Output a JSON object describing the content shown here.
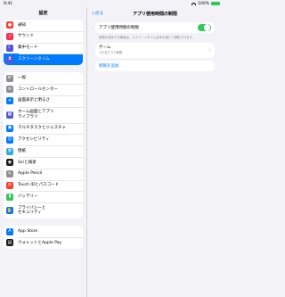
{
  "status_bar": {
    "time": "9:41",
    "battery": "100%"
  },
  "sidebar": {
    "title": "設定",
    "groups": [
      [
        {
          "label": "通知",
          "icon": "bell-icon",
          "color": "#ff3b30"
        },
        {
          "label": "サウンド",
          "icon": "speaker-icon",
          "color": "#ff2d55"
        },
        {
          "label": "集中モード",
          "icon": "moon-icon",
          "color": "#5856d6"
        },
        {
          "label": "スクリーンタイム",
          "icon": "hourglass-icon",
          "color": "#5856d6",
          "selected": true
        }
      ],
      [
        {
          "label": "一般",
          "icon": "gear-icon",
          "color": "#8e8e93"
        },
        {
          "label": "コントロールセンター",
          "icon": "toggles-icon",
          "color": "#8e8e93"
        },
        {
          "label": "画面表示と明るさ",
          "icon": "brightness-icon",
          "color": "#007aff"
        },
        {
          "label": "ホーム画面とアプリ\nライブラリ",
          "icon": "home-grid-icon",
          "color": "#5856d6"
        },
        {
          "label": "マルチタスクとジェスチャ",
          "icon": "multitask-icon",
          "color": "#007aff"
        },
        {
          "label": "アクセシビリティ",
          "icon": "accessibility-icon",
          "color": "#007aff"
        },
        {
          "label": "壁紙",
          "icon": "wallpaper-icon",
          "color": "#34aadc"
        },
        {
          "label": "Siriと検索",
          "icon": "siri-icon",
          "color": "#1c1c1e"
        },
        {
          "label": "Apple Pencil",
          "icon": "pencil-icon",
          "color": "#8e8e93"
        },
        {
          "label": "Touch IDとパスコード",
          "icon": "fingerprint-icon",
          "color": "#ff3b30"
        },
        {
          "label": "バッテリー",
          "icon": "battery-icon",
          "color": "#34c759"
        },
        {
          "label": "プライバシーと\nセキュリティ",
          "icon": "hand-icon",
          "color": "#007aff"
        }
      ],
      [
        {
          "label": "App Store",
          "icon": "appstore-icon",
          "color": "#007aff"
        },
        {
          "label": "ウォレットとApple Pay",
          "icon": "wallet-icon",
          "color": "#1c1c1e"
        }
      ]
    ]
  },
  "detail": {
    "back_label": "戻る",
    "title": "アプリ使用時間の制限",
    "toggle_label": "アプリ使用時間の制限",
    "toggle_on": true,
    "footnote": "制限を追加する機能は、スクリーンタイム全体を通じて通知されます。",
    "limits": [
      {
        "name": "ゲーム",
        "time": "1日当たり1時間"
      }
    ],
    "add_label": "制限を追加"
  }
}
